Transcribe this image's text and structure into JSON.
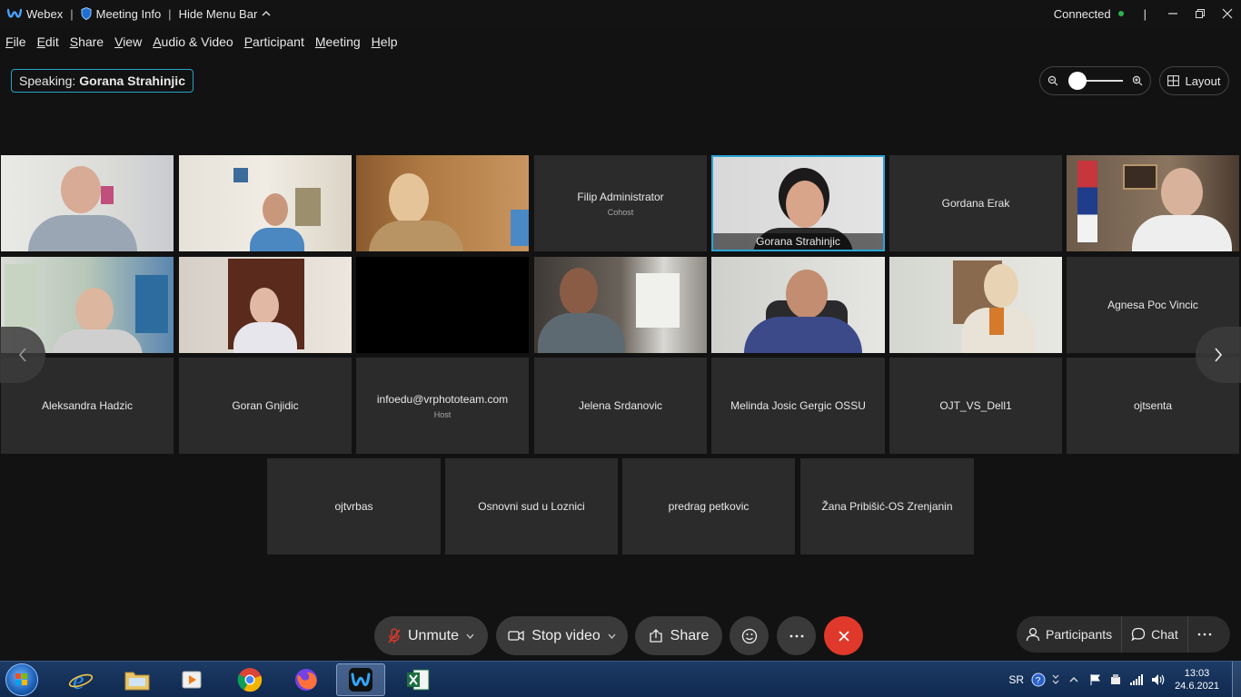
{
  "titlebar": {
    "app_name": "Webex",
    "meeting_info": "Meeting Info",
    "hide_menu_bar": "Hide Menu Bar",
    "status": "Connected"
  },
  "menubar": {
    "items": [
      {
        "key": "F",
        "rest": "ile"
      },
      {
        "key": "E",
        "rest": "dit"
      },
      {
        "key": "S",
        "rest": "hare"
      },
      {
        "key": "V",
        "rest": "iew"
      },
      {
        "key": "A",
        "rest": "udio & Video"
      },
      {
        "key": "P",
        "rest": "articipant"
      },
      {
        "key": "M",
        "rest": "eeting"
      },
      {
        "key": "H",
        "rest": "elp"
      }
    ]
  },
  "speaking": {
    "label": "Speaking:",
    "name": "Gorana Strahinjic"
  },
  "layout_button": "Layout",
  "tiles": [
    {
      "name": "",
      "role": "",
      "video": true
    },
    {
      "name": "",
      "role": "",
      "video": true
    },
    {
      "name": "",
      "role": "",
      "video": true
    },
    {
      "name": "Filip Administrator",
      "role": "Cohost",
      "video": false
    },
    {
      "name": "Gorana Strahinjic",
      "role": "",
      "video": true
    },
    {
      "name": "Gordana Erak",
      "role": "",
      "video": false
    },
    {
      "name": "",
      "role": "",
      "video": true
    },
    {
      "name": "",
      "role": "",
      "video": true
    },
    {
      "name": "",
      "role": "",
      "video": true
    },
    {
      "name": "",
      "role": "",
      "video": true
    },
    {
      "name": "",
      "role": "",
      "video": true
    },
    {
      "name": "",
      "role": "",
      "video": true
    },
    {
      "name": "",
      "role": "",
      "video": true
    },
    {
      "name": "Agnesa Poc Vincic",
      "role": "",
      "video": false
    },
    {
      "name": "Aleksandra Hadzic",
      "role": "",
      "video": false
    },
    {
      "name": "Goran Gnjidic",
      "role": "",
      "video": false
    },
    {
      "name": "infoedu@vrphototeam.com",
      "role": "Host",
      "video": false
    },
    {
      "name": "Jelena Srdanovic",
      "role": "",
      "video": false
    },
    {
      "name": "Melinda Josic Gergic OSSU",
      "role": "",
      "video": false
    },
    {
      "name": "OJT_VS_Dell1",
      "role": "",
      "video": false
    },
    {
      "name": "ojtsenta",
      "role": "",
      "video": false
    },
    {
      "name": "ojtvrbas",
      "role": "",
      "video": false
    },
    {
      "name": "Osnovni sud u Loznici",
      "role": "",
      "video": false
    },
    {
      "name": "predrag petkovic",
      "role": "",
      "video": false
    },
    {
      "name": "Žana Pribišić-OS Zrenjanin",
      "role": "",
      "video": false
    }
  ],
  "controls": {
    "unmute": "Unmute",
    "stop_video": "Stop video",
    "share": "Share",
    "participants": "Participants",
    "chat": "Chat"
  },
  "taskbar": {
    "language": "SR",
    "time": "13:03",
    "date": "24.6.2021"
  },
  "colors": {
    "accent": "#2aa3c6",
    "end_call": "#e0392b",
    "connected": "#2bb24c"
  }
}
